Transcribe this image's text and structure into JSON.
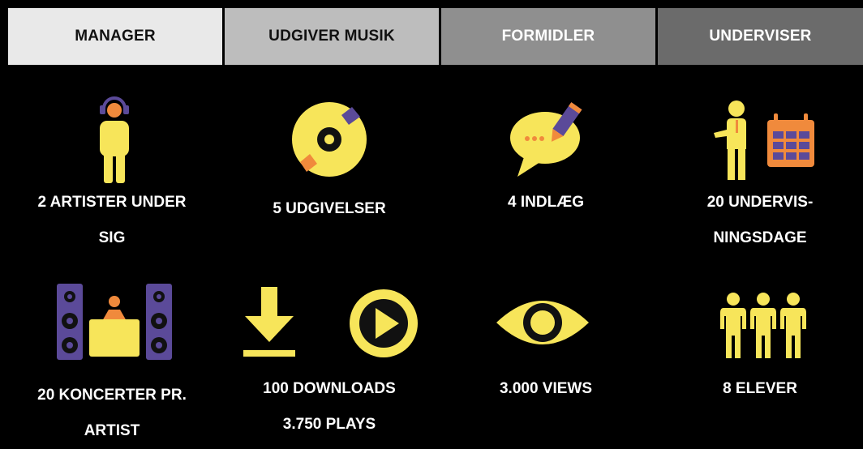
{
  "tabs": [
    {
      "label": "MANAGER"
    },
    {
      "label": "UDGIVER MUSIK"
    },
    {
      "label": "FORMIDLER"
    },
    {
      "label": "UNDERVISER"
    }
  ],
  "stats": {
    "manager_artists": {
      "line1": "2 ARTISTER UNDER",
      "line2": "SIG"
    },
    "releases": "5 UDGIVELSER",
    "posts": "4 INDLÆG",
    "teaching_days": {
      "line1": "20 UNDERVIS-",
      "line2": "NINGSDAGE"
    },
    "concerts": {
      "line1": "20 KONCERTER PR.",
      "line2": "ARTIST"
    },
    "downloads": "100 DOWNLOADS",
    "plays": "3.750 PLAYS",
    "views": "3.000 VIEWS",
    "students": "8 ELEVER"
  },
  "colors": {
    "yellow": "#f7e55a",
    "orange": "#f08a3c",
    "purple": "#5b4a99",
    "background": "#000000"
  },
  "icons": [
    "headphones-person-icon",
    "vinyl-record-icon",
    "speech-bubble-pencil-icon",
    "teacher-calendar-icon",
    "dj-speakers-icon",
    "download-icon",
    "play-icon",
    "eye-icon",
    "students-group-icon"
  ]
}
